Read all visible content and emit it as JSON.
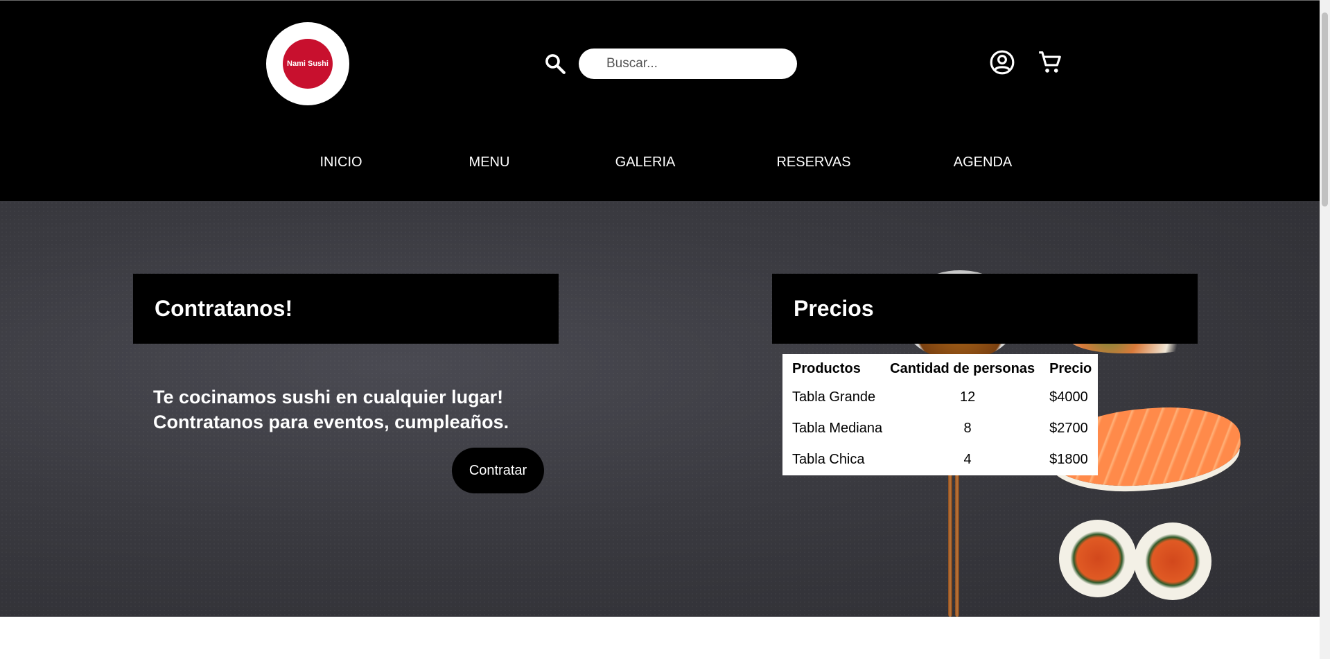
{
  "header": {
    "logo_text": "Nami Sushi",
    "search": {
      "placeholder": "Buscar...",
      "value": ""
    },
    "icons": {
      "search": "search-icon",
      "account": "account-circle-icon",
      "cart": "shopping-cart-icon"
    }
  },
  "nav": {
    "items": [
      {
        "label": "INICIO"
      },
      {
        "label": "MENU"
      },
      {
        "label": "GALERIA"
      },
      {
        "label": "RESERVAS"
      },
      {
        "label": "AGENDA"
      }
    ]
  },
  "hire": {
    "title": "Contratanos!",
    "text_line1": "Te cocinamos sushi en cualquier lugar!",
    "text_line2": "Contratanos para eventos, cumpleaños.",
    "button_label": "Contratar"
  },
  "prices": {
    "title": "Precios",
    "columns": [
      "Productos",
      "Cantidad de personas",
      "Precio"
    ],
    "rows": [
      [
        "Tabla Grande",
        "12",
        "$4000"
      ],
      [
        "Tabla Mediana",
        "8",
        "$2700"
      ],
      [
        "Tabla Chica",
        "4",
        "$1800"
      ]
    ]
  },
  "colors": {
    "header_bg": "#000000",
    "logo_red": "#c8102e",
    "hero_bg": "#3a3a40",
    "table_bg": "#ffffff"
  }
}
